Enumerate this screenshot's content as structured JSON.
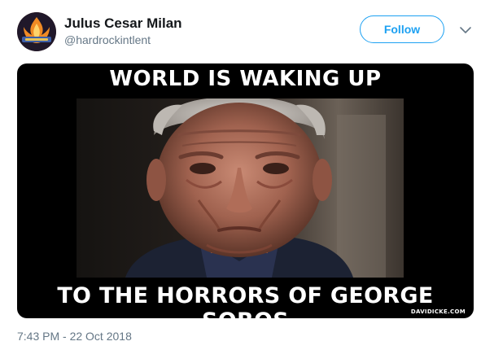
{
  "user": {
    "display_name": "Julus Cesar Milan",
    "handle": "@hardrockintlent"
  },
  "actions": {
    "follow_label": "Follow",
    "more_icon": "chevron-down-icon"
  },
  "media": {
    "caption_top": "WORLD IS WAKING UP",
    "caption_bottom": "TO THE HORRORS OF GEORGE SOROS",
    "watermark": "DAVIDICKE.COM"
  },
  "meta": {
    "timestamp": "7:43 PM - 22 Oct 2018"
  },
  "colors": {
    "accent": "#1da1f2",
    "name_text": "#14171a",
    "secondary_text": "#657786"
  }
}
